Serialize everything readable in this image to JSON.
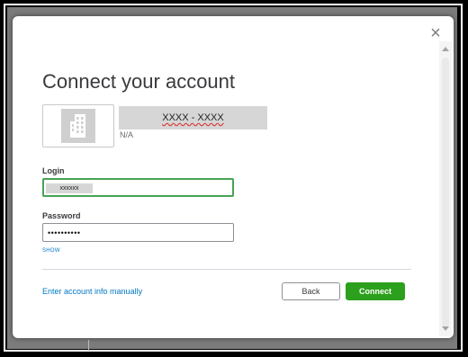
{
  "dialog": {
    "title": "Connect your account",
    "close_glyph": "×",
    "bank": {
      "name": "XXXX - XXXX",
      "sub": "N/A",
      "logo_icon": "building-icon"
    },
    "login": {
      "label": "Login",
      "value": "xxxxxx"
    },
    "password": {
      "label": "Password",
      "value": "••••••••••",
      "show_label": "SHOW"
    },
    "manual_link": "Enter account info manually",
    "buttons": {
      "back": "Back",
      "connect": "Connect"
    },
    "colors": {
      "accent_green": "#2ca01c",
      "link_blue": "#0077c5",
      "focus_green": "#48a355"
    }
  }
}
